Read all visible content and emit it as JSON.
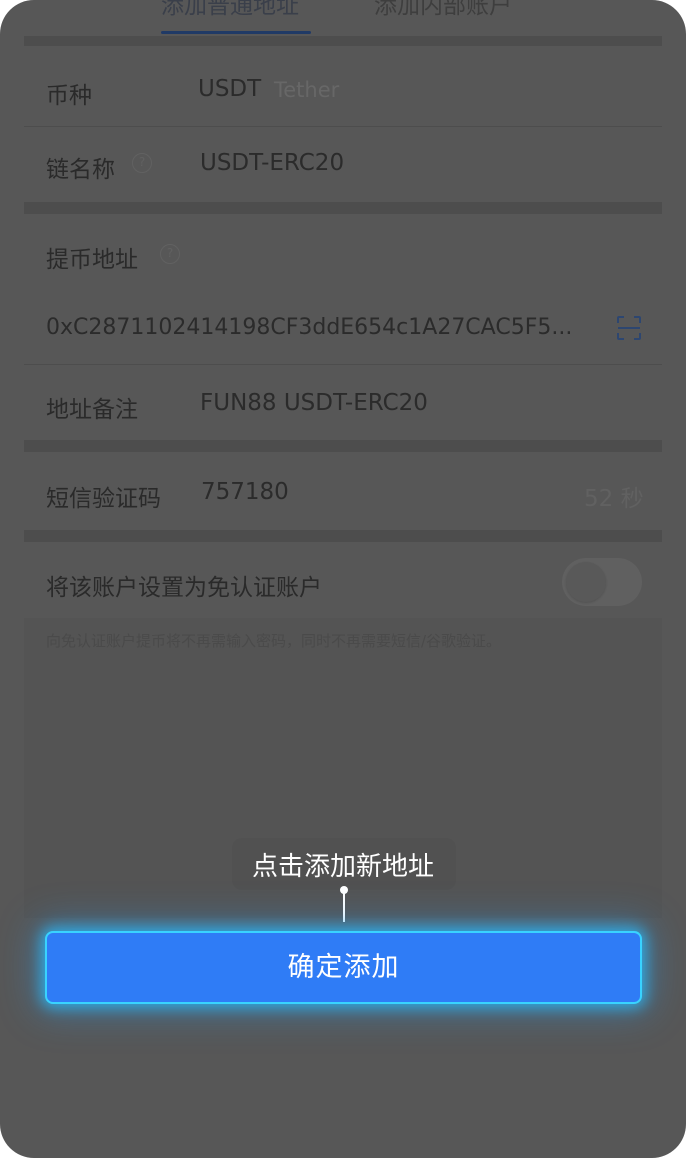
{
  "tabs": {
    "normal_address": "添加普通地址",
    "internal_account": "添加内部账户"
  },
  "form": {
    "currency": {
      "label": "币种",
      "value": "USDT",
      "sub": "Tether"
    },
    "chain": {
      "label": "链名称",
      "value": "USDT-ERC20"
    },
    "address": {
      "label": "提币地址",
      "value": "0xC2871102414198CF3ddE654c1A27CAC5F5..."
    },
    "remark": {
      "label": "地址备注",
      "value": "FUN88 USDT-ERC20"
    },
    "sms": {
      "label": "短信验证码",
      "value": "757180",
      "countdown": "52 秒"
    },
    "trusted": {
      "label": "将该账户设置为免认证账户",
      "note": "向免认证账户提币将不再需输入密码，同时不再需要短信/谷歌验证。",
      "enabled": false
    }
  },
  "tooltip": {
    "text": "点击添加新地址"
  },
  "confirm_button": {
    "label": "确定添加"
  },
  "colors": {
    "overlay": "#575757",
    "button": "#2f7cf6",
    "button_glow": "#39d3ff"
  },
  "icons": {
    "help": "help-circle-icon",
    "scan": "scan-icon"
  }
}
